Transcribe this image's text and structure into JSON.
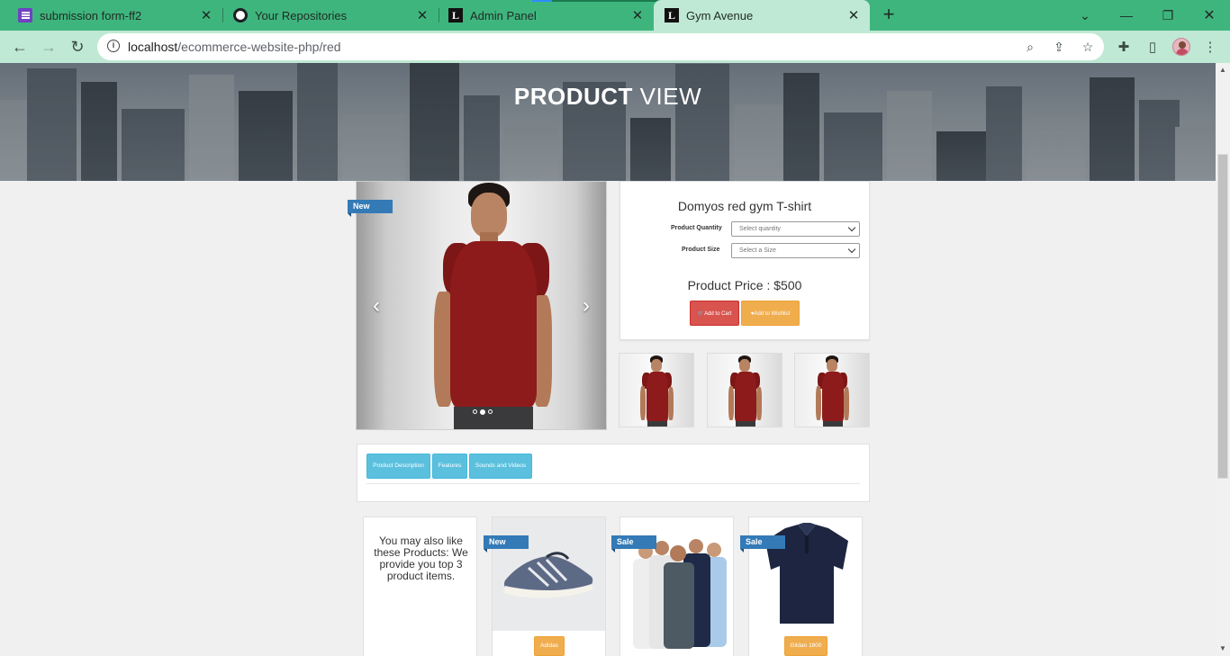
{
  "browser": {
    "tabs": [
      {
        "title": "submission form-ff2",
        "icon": "form-icon",
        "active": false
      },
      {
        "title": "Your Repositories",
        "icon": "github-icon",
        "active": false
      },
      {
        "title": "Admin Panel",
        "icon": "site-l-icon",
        "active": false
      },
      {
        "title": "Gym Avenue",
        "icon": "site-l-icon",
        "active": true
      }
    ],
    "url_host": "localhost",
    "url_path": "/ecommerce-website-php/red",
    "theme_color": "#3fb57e"
  },
  "hero": {
    "title_bold": "PRODUCT",
    "title_light": " VIEW"
  },
  "product": {
    "badge": "New",
    "name": "Domyos red gym T-shirt",
    "quantity_label": "Product Quantity",
    "quantity_placeholder": "Select quantity",
    "size_label": "Product Size",
    "size_placeholder": "Select a Size",
    "price": "Product Price : $500",
    "add_to_cart": "Add to Cart",
    "add_to_wishlist": "Add to Wishlist",
    "carousel_slides": 3,
    "carousel_active": 2
  },
  "tabs": [
    {
      "label": "Product Description"
    },
    {
      "label": "Features"
    },
    {
      "label": "Sounds and Videos"
    }
  ],
  "related": {
    "intro": "You may also like these Products: We provide you top 3 product items.",
    "items": [
      {
        "badge": "New",
        "brand": "Adidas",
        "image": "running-shoe"
      },
      {
        "badge": "Sale",
        "brand": "",
        "image": "group-tshirts"
      },
      {
        "badge": "Sale",
        "brand": "Gildan 1800",
        "image": "navy-polo"
      }
    ]
  },
  "colors": {
    "ribbon": "#337ab7",
    "cart": "#d9534f",
    "wishlist": "#f0ad4e",
    "tab": "#5bc0de",
    "shirt": "#8d1b1b"
  }
}
